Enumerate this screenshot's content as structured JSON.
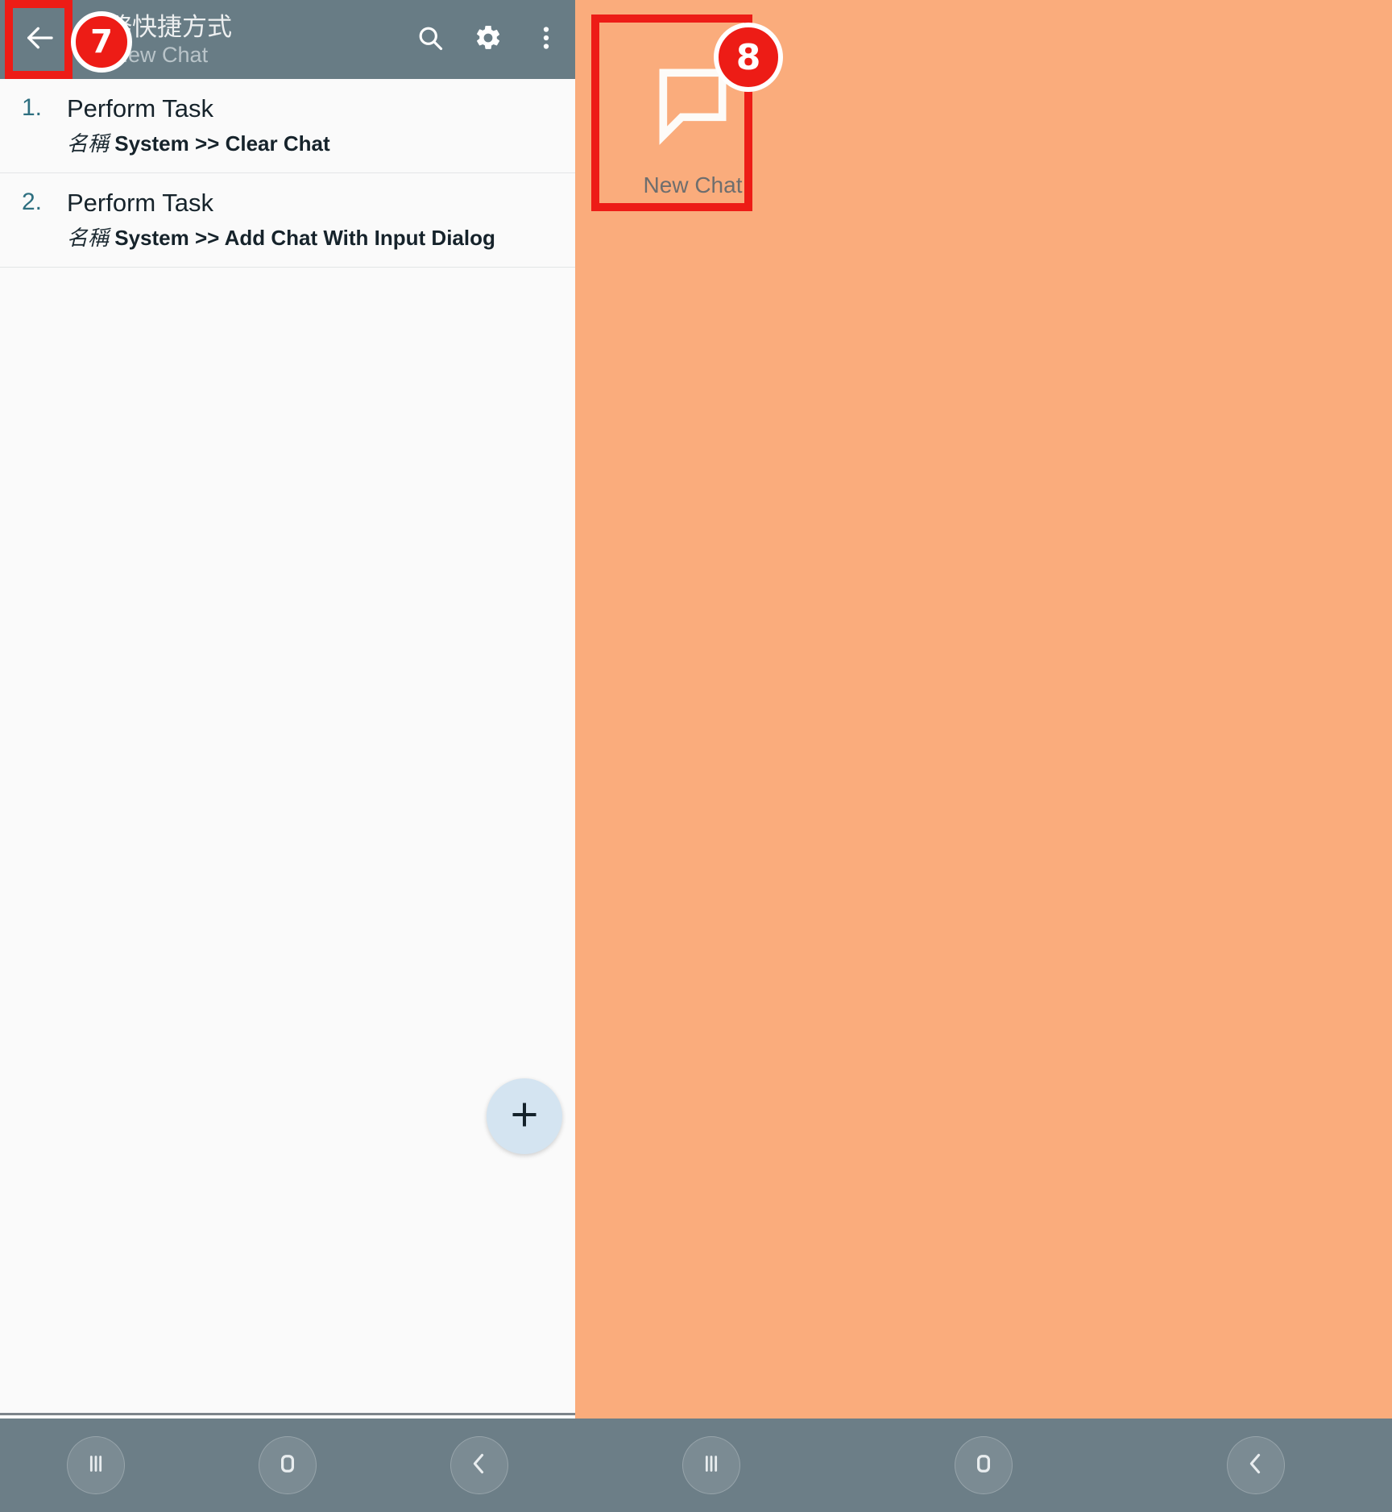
{
  "app": {
    "toolbar": {
      "back_icon": "arrow-back-icon",
      "title": "任務快捷方式",
      "subtitle": "2 / New Chat",
      "search_icon": "search-icon",
      "settings_icon": "gear-icon",
      "overflow_icon": "more-vertical-icon"
    },
    "actions": [
      {
        "number": "1.",
        "name": "Perform Task",
        "param_label": "名稱",
        "param_value": "System >> Clear Chat"
      },
      {
        "number": "2.",
        "name": "Perform Task",
        "param_label": "名稱",
        "param_value": "System >> Add Chat With Input Dialog"
      }
    ],
    "bottom_bar": {
      "chat_icon": "chat-bubble-icon"
    },
    "fab": {
      "icon": "plus-icon",
      "label": "Add Action"
    }
  },
  "home_screen": {
    "shortcut": {
      "icon": "chat-bubble-icon",
      "label": "New Chat"
    },
    "background_color": "#FAAC7C"
  },
  "navigation_bar": {
    "recents": "recents-icon",
    "home": "home-icon",
    "back": "back-icon"
  },
  "annotations": [
    {
      "id": "7",
      "target": "back-button"
    },
    {
      "id": "8",
      "target": "new-chat-shortcut"
    }
  ],
  "colors": {
    "toolbar": "#687C85",
    "accent": "#1C7EA0",
    "annotation_red": "#ED1C16",
    "home_background": "#FAAC7C",
    "fab": "#D4E4F1"
  }
}
